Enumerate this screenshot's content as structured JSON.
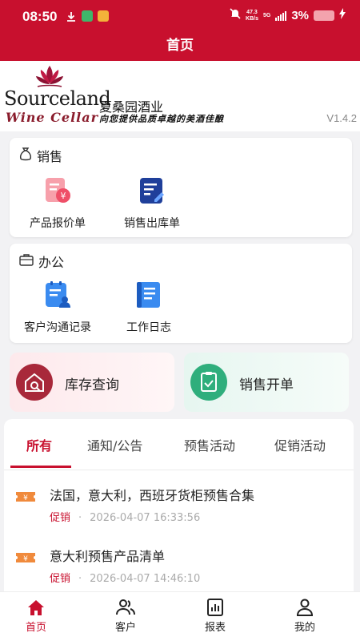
{
  "status_bar": {
    "time": "08:50",
    "net_speed_value": "47.3",
    "net_speed_unit": "KB/s",
    "network": "5G",
    "battery": "3%",
    "accent": "#c8102e"
  },
  "header": {
    "title": "首页"
  },
  "brand": {
    "name_en": "Sourceland",
    "subtitle_en": "Wine Cellar",
    "name_cn": "夏桑园酒业",
    "slogan": "向您提供品质卓越的美酒佳酿",
    "version": "V1.4.2"
  },
  "sales": {
    "title": "销售",
    "items": [
      {
        "label": "产品报价单",
        "icon": "quote-document-icon"
      },
      {
        "label": "销售出库单",
        "icon": "outbound-order-icon"
      }
    ]
  },
  "office": {
    "title": "办公",
    "items": [
      {
        "label": "客户沟通记录",
        "icon": "customer-record-icon"
      },
      {
        "label": "工作日志",
        "icon": "work-log-icon"
      }
    ]
  },
  "quick_actions": [
    {
      "label": "库存查询",
      "icon": "warehouse-search-icon"
    },
    {
      "label": "销售开单",
      "icon": "clipboard-check-icon"
    }
  ],
  "news": {
    "tabs": [
      "所有",
      "通知/公告",
      "预售活动",
      "促销活动"
    ],
    "active_tab": "所有",
    "items": [
      {
        "title": "法国，意大利，西班牙货柜预售合集",
        "type": "促销",
        "date": "2026-04-07 16:33:56"
      },
      {
        "title": "意大利预售产品清单",
        "type": "促销",
        "date": "2026-04-07 14:46:10"
      }
    ]
  },
  "tab_bar": {
    "items": [
      {
        "label": "首页",
        "icon": "home-icon"
      },
      {
        "label": "客户",
        "icon": "users-icon"
      },
      {
        "label": "报表",
        "icon": "report-icon"
      },
      {
        "label": "我的",
        "icon": "person-icon"
      }
    ],
    "active": "首页"
  }
}
